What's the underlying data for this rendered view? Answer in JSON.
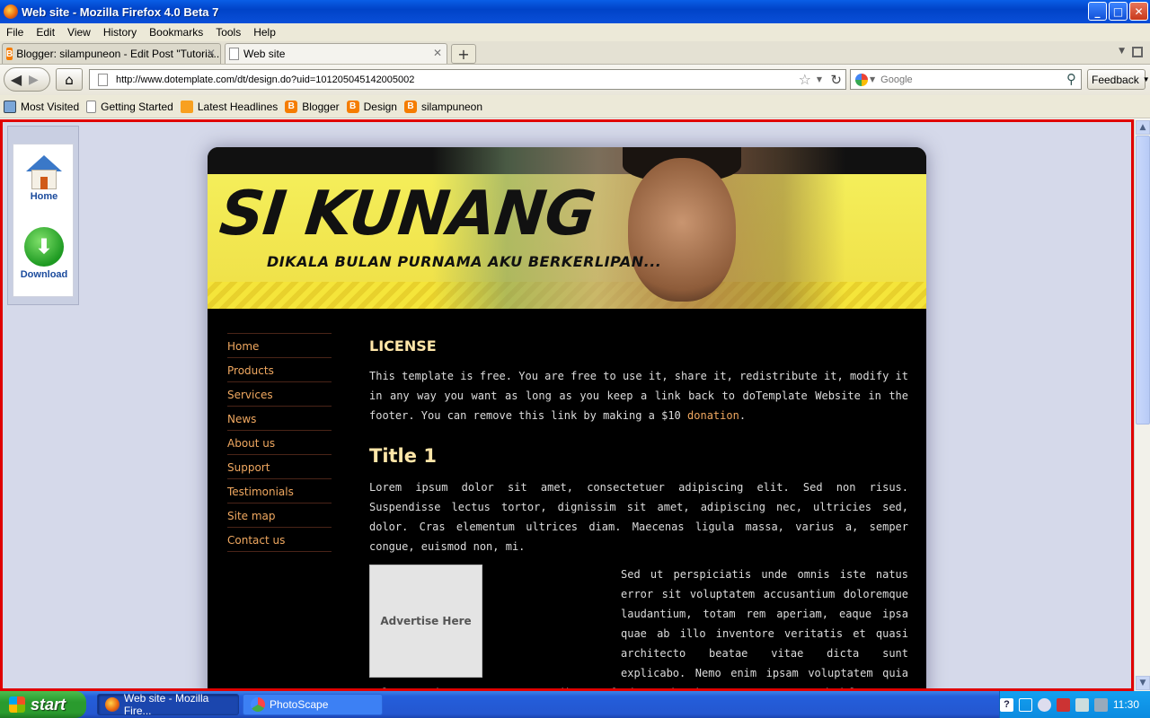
{
  "window": {
    "title": "Web site - Mozilla Firefox 4.0 Beta 7",
    "buttons": {
      "minimize": "_",
      "maximize": "□",
      "close": "✕"
    }
  },
  "menu": [
    "File",
    "Edit",
    "View",
    "History",
    "Bookmarks",
    "Tools",
    "Help"
  ],
  "tabs": [
    {
      "label": "Blogger: silampuneon - Edit Post \"Tutoria...",
      "icon": "blogger-icon",
      "active": false
    },
    {
      "label": "Web site",
      "icon": "page-icon",
      "active": true
    }
  ],
  "new_tab_label": "+",
  "navbar": {
    "url": "http://www.dotemplate.com/dt/design.do?uid=101205045142005002",
    "search_placeholder": "Google",
    "feedback_label": "Feedback"
  },
  "bookmarks": [
    {
      "label": "Most Visited",
      "icon": "most-visited-icon"
    },
    {
      "label": "Getting Started",
      "icon": "page-icon"
    },
    {
      "label": "Latest Headlines",
      "icon": "rss-icon"
    },
    {
      "label": "Blogger",
      "icon": "blogger-icon"
    },
    {
      "label": "Design",
      "icon": "blogger-icon"
    },
    {
      "label": "silampuneon",
      "icon": "blogger-icon"
    }
  ],
  "widget": {
    "home_label": "Home",
    "download_label": "Download"
  },
  "site": {
    "logo": "SI KUNANG",
    "tagline": "DIKALA BULAN PURNAMA AKU BERKERLIPAN...",
    "nav": [
      "Home",
      "Products",
      "Services",
      "News",
      "About us",
      "Support",
      "Testimonials",
      "Site map",
      "Contact us"
    ],
    "license_heading": "LICENSE",
    "license_text": "This template is free. You are free to use it, share it, redistribute it, modify it in any way you want as long as you keep a link back to doTemplate Website in the footer. You can remove this link by making a $10 ",
    "license_link": "donation",
    "license_end": ".",
    "title1": "Title 1",
    "para1": "Lorem ipsum dolor sit amet, consectetuer adipiscing elit. Sed non risus. Suspendisse lectus tortor, dignissim sit amet, adipiscing nec, ultricies sed, dolor. Cras elementum ultrices diam. Maecenas ligula massa, varius a, semper congue, euismod non, mi.",
    "advert": "Advertise Here",
    "para2": "Sed ut perspiciatis unde omnis iste natus error sit voluptatem accusantium doloremque laudantium, totam rem aperiam, eaque ipsa quae ab illo inventore veritatis et quasi architecto beatae vitae dicta sunt explicabo. Nemo enim ipsam voluptatem quia voluptas sit aspernatur aut odit aut fugit, sed quia consequuntur magni dolores eos qui ratione voluptatem sequi nesciunt. Lorem ipsum dolor sit amet,"
  },
  "taskbar": {
    "start_label": "start",
    "tasks": [
      {
        "label": "Web site - Mozilla Fire...",
        "active": true
      },
      {
        "label": "PhotoScape",
        "active": false
      }
    ],
    "clock": "11:30"
  }
}
